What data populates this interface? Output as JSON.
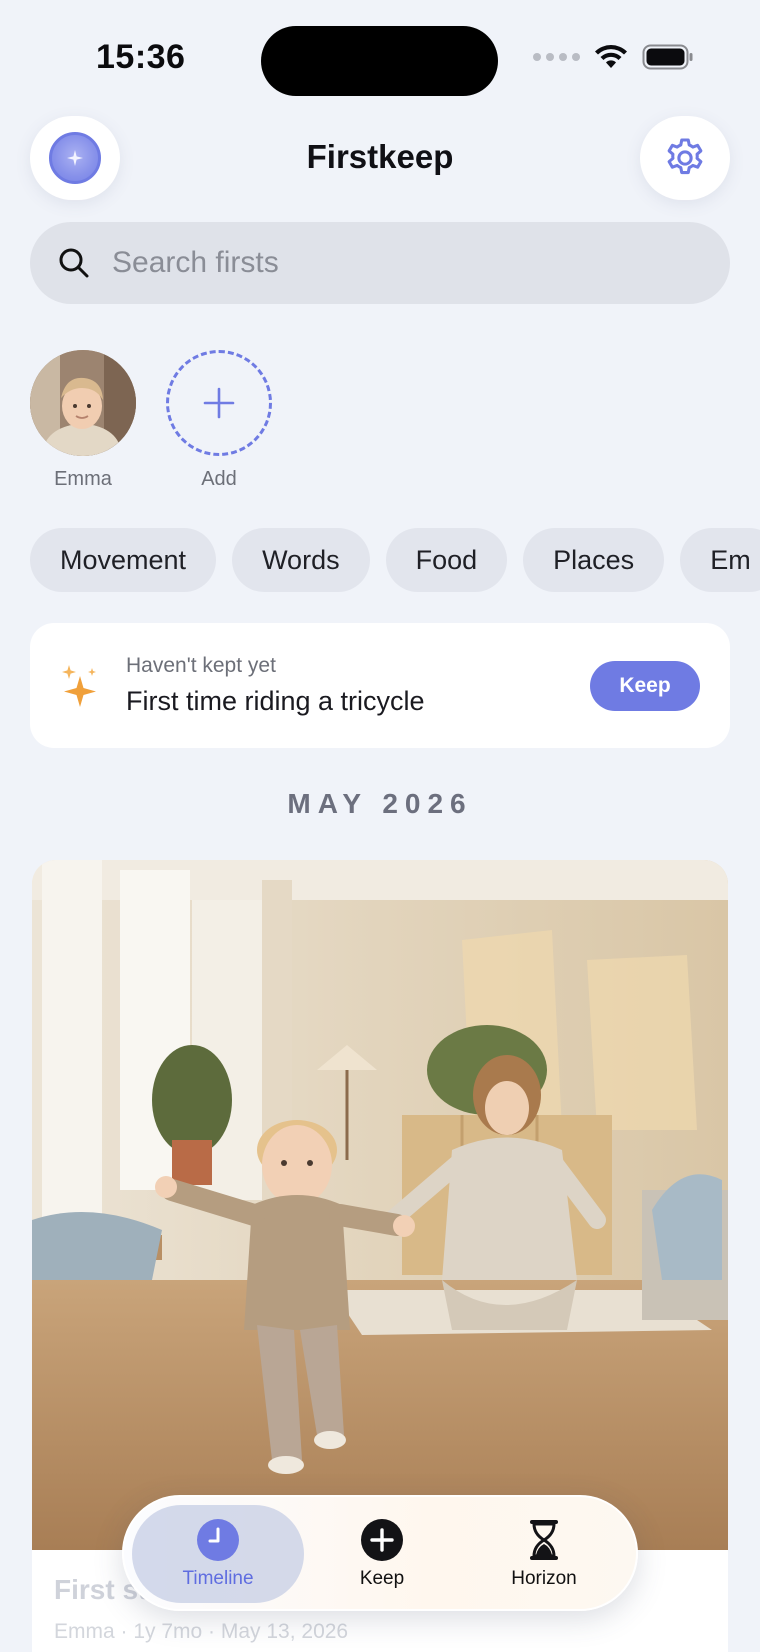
{
  "status_bar": {
    "time": "15:36"
  },
  "header": {
    "title": "Firstkeep"
  },
  "search": {
    "placeholder": "Search firsts"
  },
  "children": [
    {
      "name": "Emma"
    },
    {
      "name": "Add"
    }
  ],
  "categories": [
    "Movement",
    "Words",
    "Food",
    "Places",
    "Em"
  ],
  "reminder": {
    "kicker": "Haven't kept yet",
    "title": "First time riding a tricycle",
    "button": "Keep"
  },
  "timeline": {
    "month": "MAY 2026",
    "entries": [
      {
        "title": "First st",
        "meta": "Emma · 1y 7mo · May 13, 2026"
      }
    ]
  },
  "tabbar": {
    "items": [
      {
        "label": "Timeline",
        "icon": "clock-icon",
        "active": true
      },
      {
        "label": "Keep",
        "icon": "plus-circle-icon",
        "active": false
      },
      {
        "label": "Horizon",
        "icon": "hourglass-icon",
        "active": false
      }
    ]
  },
  "colors": {
    "accent": "#6f7be3",
    "background": "#f0f3f9",
    "sparkle": "#f0a03a"
  }
}
